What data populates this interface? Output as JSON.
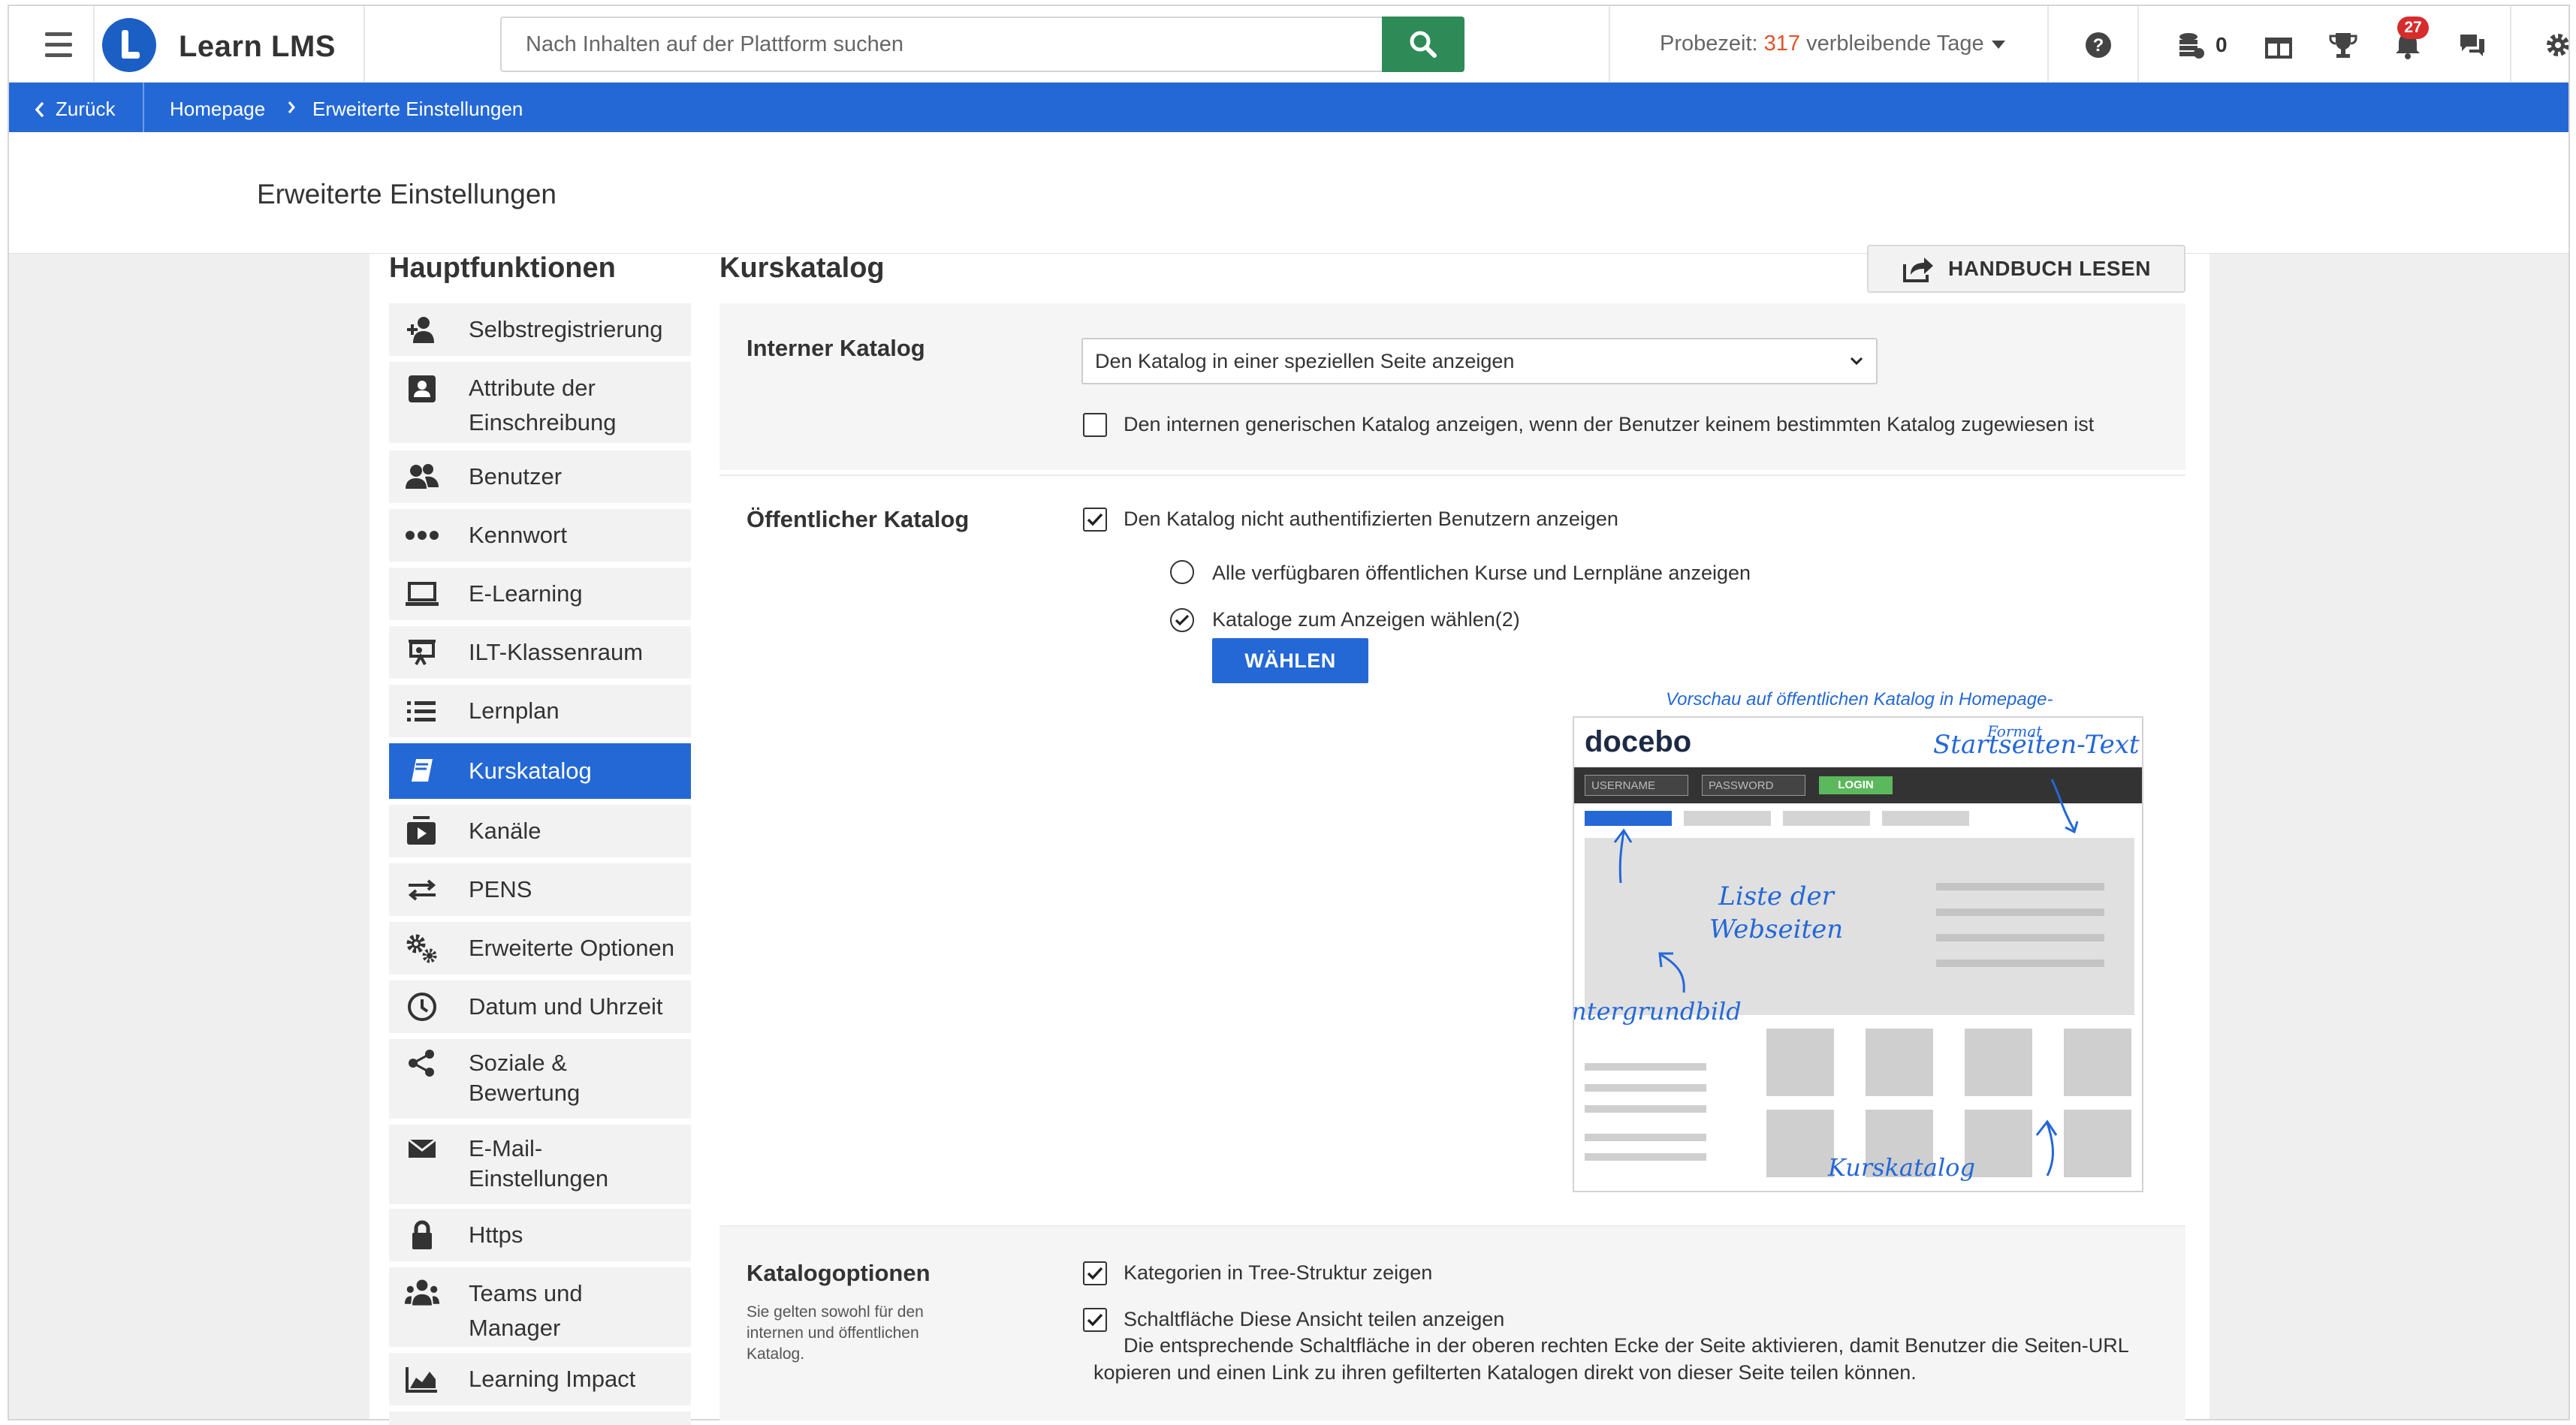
{
  "app": {
    "logo_text": "Learn LMS",
    "brand_color": "#2468d6"
  },
  "topbar": {
    "search_placeholder": "Nach Inhalten auf der Plattform suchen",
    "trial_prefix": "Probezeit: ",
    "trial_days": "317",
    "trial_suffix": " verbleibende Tage",
    "coins": "0",
    "notifications": "27"
  },
  "breadcrumb": {
    "back": "Zurück",
    "home": "Homepage",
    "current": "Erweiterte Einstellungen"
  },
  "page_title": "Erweiterte Einstellungen",
  "sidebar": {
    "heading": "Hauptfunktionen",
    "items": [
      {
        "label": "Selbstregistrierung",
        "icon": "user-plus-icon"
      },
      {
        "label": "Attribute der Einschreibung",
        "icon": "contact-card-icon"
      },
      {
        "label": "Benutzer",
        "icon": "users-icon"
      },
      {
        "label": "Kennwort",
        "icon": "dots-icon"
      },
      {
        "label": "E-Learning",
        "icon": "laptop-icon"
      },
      {
        "label": "ILT-Klassenraum",
        "icon": "presentation-icon"
      },
      {
        "label": "Lernplan",
        "icon": "list-icon"
      },
      {
        "label": "Kurskatalog",
        "icon": "book-icon",
        "active": true
      },
      {
        "label": "Kanäle",
        "icon": "play-stack-icon"
      },
      {
        "label": "PENS",
        "icon": "swap-arrows-icon"
      },
      {
        "label": "Erweiterte Optionen",
        "icon": "gears-icon"
      },
      {
        "label": "Datum und Uhrzeit",
        "icon": "clock-icon"
      },
      {
        "label": "Soziale & Bewertung",
        "icon": "share-icon"
      },
      {
        "label": "E-Mail-Einstellungen",
        "icon": "envelope-icon"
      },
      {
        "label": "Https",
        "icon": "lock-icon"
      },
      {
        "label": "Teams und Manager",
        "icon": "team-icon"
      },
      {
        "label": "Learning Impact",
        "icon": "area-chart-icon"
      }
    ]
  },
  "main": {
    "heading": "Kurskatalog",
    "manual_button": "HANDBUCH LESEN",
    "internal": {
      "label": "Interner Katalog",
      "select_value": "Den Katalog in einer speziellen Seite anzeigen",
      "checkbox_label": "Den internen generischen Katalog anzeigen, wenn der Benutzer keinem bestimmten Katalog zugewiesen ist",
      "checkbox_checked": false
    },
    "public": {
      "label": "Öffentlicher Katalog",
      "checkbox_label": "Den Katalog nicht authentifizierten Benutzern anzeigen",
      "checkbox_checked": true,
      "radio_all": "Alle verfügbaren öffentlichen Kurse und Lernpläne anzeigen",
      "radio_choose": "Kataloge zum Anzeigen wählen(2)",
      "choose_button": "WÄHLEN",
      "preview": {
        "caption": "Vorschau auf öffentlichen Katalog in Homepage-",
        "caption_2": "Format",
        "brand": "docebo",
        "username": "USERNAME",
        "password": "PASSWORD",
        "login": "LOGIN",
        "note_homepage_text": "Startseiten-Text",
        "note_webpages_1": "Liste der",
        "note_webpages_2": "Webseiten",
        "note_background": "Hintergrundbild",
        "note_catalog": "Kurskatalog"
      }
    },
    "options": {
      "label": "Katalogoptionen",
      "sub": "Sie gelten sowohl für den internen und öffentlichen Katalog.",
      "tree_label": "Kategorien in Tree-Struktur zeigen",
      "share_label": "Schaltfläche Diese Ansicht teilen anzeigen",
      "share_desc": "Die entsprechende Schaltfläche in der oberen rechten Ecke der Seite aktivieren, damit Benutzer die Seiten-URL kopieren und einen Link zu ihren gefilterten Katalogen direkt von dieser Seite teilen können."
    }
  }
}
